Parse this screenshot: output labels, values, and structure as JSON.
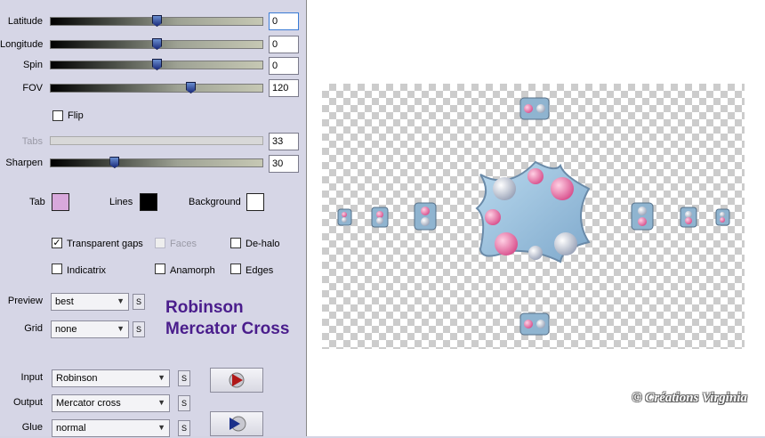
{
  "sliders": {
    "latitude": {
      "label": "Latitude",
      "value": "0",
      "fraction": 0.5
    },
    "longitude": {
      "label": "Longitude",
      "value": "0",
      "fraction": 0.5
    },
    "spin": {
      "label": "Spin",
      "value": "0",
      "fraction": 0.5
    },
    "fov": {
      "label": "FOV",
      "value": "120",
      "fraction": 0.66
    },
    "tabs": {
      "label": "Tabs",
      "value": "33",
      "fraction": 0.33
    },
    "sharpen": {
      "label": "Sharpen",
      "value": "30",
      "fraction": 0.3
    }
  },
  "flip": {
    "label": "Flip",
    "checked": false
  },
  "colors": {
    "tab": {
      "label": "Tab",
      "color": "#d8a8dc"
    },
    "lines": {
      "label": "Lines",
      "color": "#000000"
    },
    "background": {
      "label": "Background",
      "color": "#ffffff"
    }
  },
  "options": {
    "transparent_gaps": {
      "label": "Transparent gaps",
      "checked": true,
      "mark": "✓"
    },
    "faces": {
      "label": "Faces",
      "checked": false
    },
    "de_halo": {
      "label": "De-halo",
      "checked": false
    },
    "indicatrix": {
      "label": "Indicatrix",
      "checked": false
    },
    "anamorph": {
      "label": "Anamorph",
      "checked": false
    },
    "edges": {
      "label": "Edges",
      "checked": false
    }
  },
  "preview_select": {
    "label": "Preview",
    "value": "best"
  },
  "grid_select": {
    "label": "Grid",
    "value": "none"
  },
  "s_button_label": "S",
  "projection_title": {
    "line1": "Robinson",
    "line2": "Mercator Cross"
  },
  "input_select": {
    "label": "Input",
    "value": "Robinson"
  },
  "output_select": {
    "label": "Output",
    "value": "Mercator cross"
  },
  "glue_select": {
    "label": "Glue",
    "value": "normal"
  },
  "watermark": "© Créations Virginia",
  "palette": {
    "accent": "#4a1d8c",
    "panel": "#d6d6e6",
    "tab_color": "#d8a8dc"
  }
}
